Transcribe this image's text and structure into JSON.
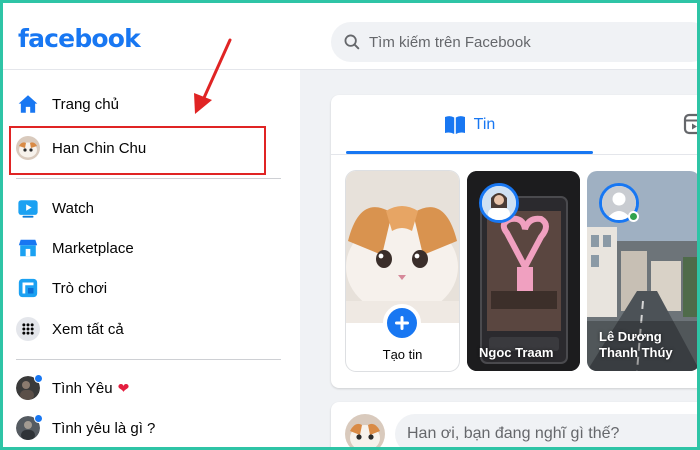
{
  "header": {
    "logo": "facebook",
    "search": {
      "placeholder": "Tìm kiếm trên Facebook",
      "icon": "search-icon"
    }
  },
  "sidebar": {
    "items": [
      {
        "label": "Trang chủ",
        "icon": "home-icon"
      },
      {
        "label": "Han Chin Chu",
        "icon": "profile-avatar"
      },
      {
        "label": "Watch",
        "icon": "watch-icon"
      },
      {
        "label": "Marketplace",
        "icon": "marketplace-icon"
      },
      {
        "label": "Trò chơi",
        "icon": "games-icon"
      },
      {
        "label": "Xem tất cả",
        "icon": "grid-icon"
      }
    ],
    "groups": [
      {
        "label": "Tình Yêu",
        "icon": "group-avatar",
        "suffix": "❤"
      },
      {
        "label": "Tình yêu là gì ?",
        "icon": "group-avatar"
      }
    ]
  },
  "stories": {
    "tabs": [
      {
        "label": "Tin",
        "icon": "book-icon",
        "active": true
      },
      {
        "label": "",
        "icon": "reels-icon",
        "active": false
      }
    ],
    "cards": [
      {
        "type": "create",
        "label": "Tạo tin"
      },
      {
        "type": "story",
        "name": "Ngoc Traam"
      },
      {
        "type": "story",
        "name": "Lê Dương Thanh Thúy",
        "online": true
      }
    ]
  },
  "composer": {
    "placeholder": "Han ơi, bạn đang nghĩ gì thế?"
  },
  "colors": {
    "brand": "#1877f2",
    "highlight": "#e02424",
    "frame": "#2ec4a6",
    "online": "#31a24c"
  }
}
